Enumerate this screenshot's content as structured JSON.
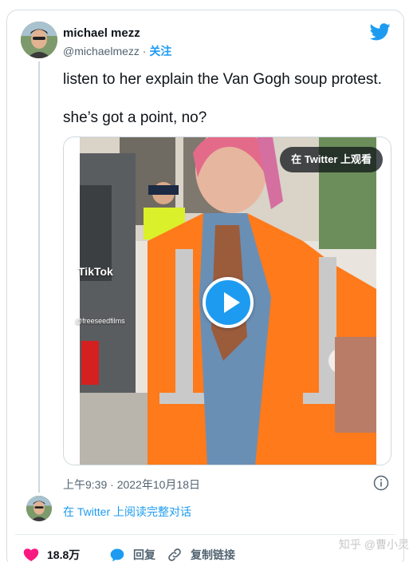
{
  "author": {
    "name": "michael mezz",
    "handle": "@michaelmezz",
    "separator": "·",
    "follow_label": "关注"
  },
  "tweet": {
    "lines": [
      "listen to her explain the Van Gogh soup protest.",
      "she’s got a point, no?"
    ]
  },
  "media": {
    "watch_on_twitter": "在 Twitter 上观看",
    "tiktok_brand": "TikTok",
    "tiktok_user": "@freeseedfilms"
  },
  "meta": {
    "timestamp": "上午9:39 · 2022年10月18日"
  },
  "thread": {
    "read_label": "在 Twitter 上阅读完整对话"
  },
  "actions": {
    "like_count": "18.8万",
    "reply_label": "回复",
    "copy_link_label": "复制链接"
  },
  "watermark": "知乎 @曹小灵",
  "colors": {
    "accent": "#1d9bf0",
    "like": "#f91880",
    "vest": "#ff7a1a"
  },
  "icons": [
    "twitter-bird-icon",
    "play-icon",
    "info-icon",
    "heart-icon",
    "reply-icon",
    "link-icon"
  ]
}
